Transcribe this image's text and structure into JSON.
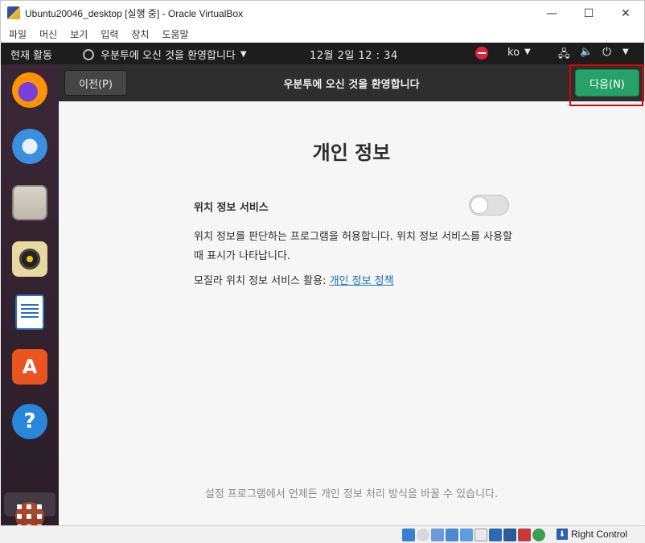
{
  "window": {
    "title": "Ubuntu20046_desktop [실행 중] - Oracle VirtualBox",
    "minimize": "—",
    "maximize": "☐",
    "close": "✕"
  },
  "menubar": {
    "items": [
      "파일",
      "머신",
      "보기",
      "입력",
      "장치",
      "도움말"
    ]
  },
  "topbar": {
    "activities": "현재 활동",
    "app_menu": "우분투에 오신 것을 환영합니다",
    "clock": "12월 2일  12 : 34",
    "lang": "ko"
  },
  "dock": {
    "items": [
      "firefox",
      "thunderbird",
      "files",
      "rhythmbox",
      "libreoffice-writer",
      "ubuntu-software",
      "help"
    ]
  },
  "installer": {
    "header_title": "우분투에 오신 것을 환영합니다",
    "prev_button": "이전(P)",
    "next_button": "다음(N)",
    "page_title": "개인 정보",
    "location_label": "위치 정보 서비스",
    "location_enabled": false,
    "description": "위치 정보를 판단하는 프로그램을 허용합니다. 위치 정보 서비스를 사용할 때 표시가 나타납니다.",
    "policy_prefix": "모질라 위치 정보 서비스 활용: ",
    "policy_link": "개인 정보 정책",
    "footer_note": "설정 프로그램에서 언제든 개인 정보 처리 방식을 바꿀 수 있습니다."
  },
  "statusbar": {
    "host_key": "Right Control"
  },
  "colors": {
    "accent_next": "#26a269",
    "highlight_box": "#e00000",
    "link": "#1a6fb8"
  }
}
